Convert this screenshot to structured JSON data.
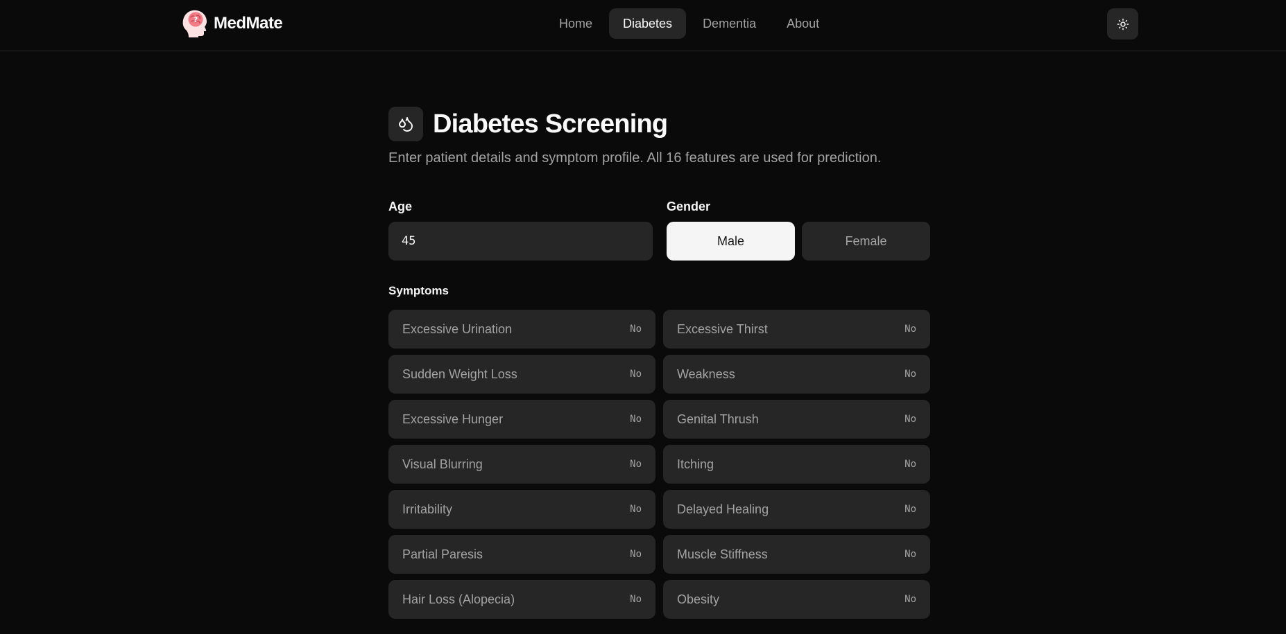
{
  "brand": {
    "name": "MedMate",
    "logo_icon": "brain-head-icon"
  },
  "nav": {
    "items": [
      {
        "label": "Home",
        "active": false
      },
      {
        "label": "Diabetes",
        "active": true
      },
      {
        "label": "Dementia",
        "active": false
      },
      {
        "label": "About",
        "active": false
      }
    ]
  },
  "theme_toggle": {
    "icon": "sun-icon"
  },
  "page": {
    "icon": "droplets-icon",
    "title": "Diabetes Screening",
    "subtitle": "Enter patient details and symptom profile. All 16 features are used for prediction."
  },
  "form": {
    "age": {
      "label": "Age",
      "value": "45"
    },
    "gender": {
      "label": "Gender",
      "options": [
        "Male",
        "Female"
      ],
      "selected": "Male"
    },
    "symptoms_label": "Symptoms",
    "symptoms": [
      {
        "label": "Excessive Urination",
        "value": "No"
      },
      {
        "label": "Excessive Thirst",
        "value": "No"
      },
      {
        "label": "Sudden Weight Loss",
        "value": "No"
      },
      {
        "label": "Weakness",
        "value": "No"
      },
      {
        "label": "Excessive Hunger",
        "value": "No"
      },
      {
        "label": "Genital Thrush",
        "value": "No"
      },
      {
        "label": "Visual Blurring",
        "value": "No"
      },
      {
        "label": "Itching",
        "value": "No"
      },
      {
        "label": "Irritability",
        "value": "No"
      },
      {
        "label": "Delayed Healing",
        "value": "No"
      },
      {
        "label": "Partial Paresis",
        "value": "No"
      },
      {
        "label": "Muscle Stiffness",
        "value": "No"
      },
      {
        "label": "Hair Loss (Alopecia)",
        "value": "No"
      },
      {
        "label": "Obesity",
        "value": "No"
      }
    ]
  },
  "colors": {
    "background": "#0a0a0a",
    "surface": "#262626",
    "text": "#fafafa",
    "muted_text": "#a3a3a3",
    "selected_bg": "#f5f5f5",
    "logo_accent": "#f07a86"
  }
}
